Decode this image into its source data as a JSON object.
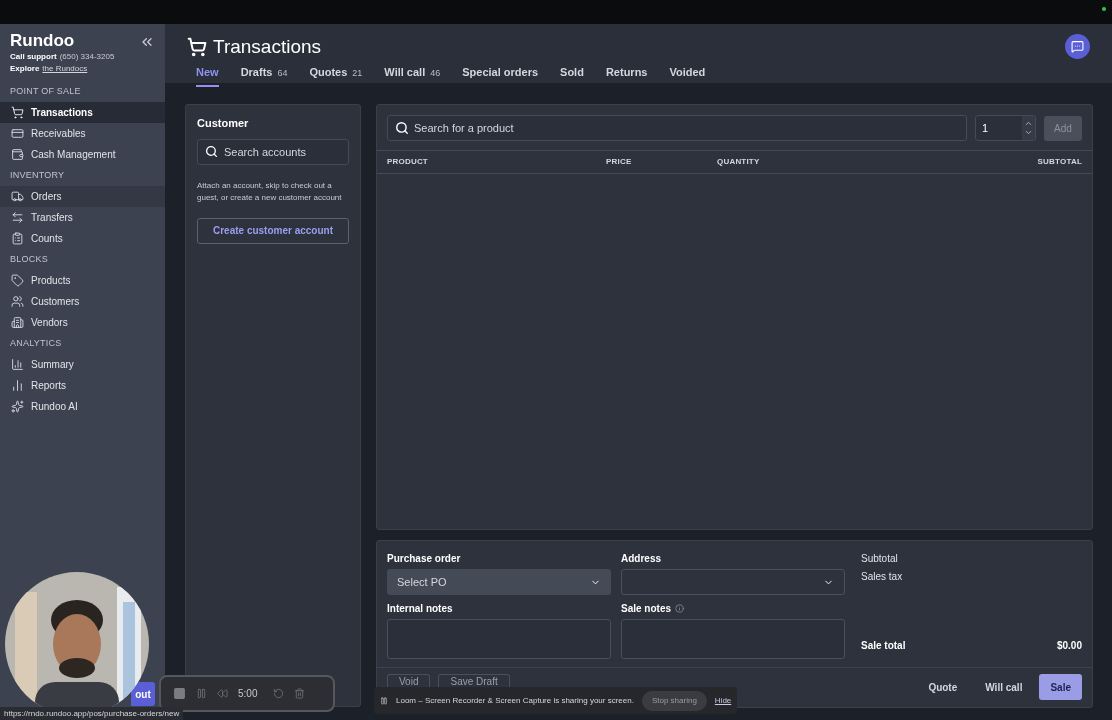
{
  "app": {
    "name": "Rundoo",
    "support_label": "Call support",
    "support_phone": "(650) 334-3205",
    "explore_label": "Explore",
    "explore_link": "the Rundocs"
  },
  "sidebar": {
    "sections": [
      {
        "title": "POINT OF SALE",
        "items": [
          {
            "label": "Transactions",
            "selected": true,
            "hovered": false
          },
          {
            "label": "Receivables",
            "selected": false,
            "hovered": false
          },
          {
            "label": "Cash Management",
            "selected": false,
            "hovered": false
          }
        ]
      },
      {
        "title": "INVENTORY",
        "items": [
          {
            "label": "Orders",
            "selected": false,
            "hovered": true
          },
          {
            "label": "Transfers",
            "selected": false,
            "hovered": false
          },
          {
            "label": "Counts",
            "selected": false,
            "hovered": false
          }
        ]
      },
      {
        "title": "BLOCKS",
        "items": [
          {
            "label": "Products",
            "selected": false,
            "hovered": false
          },
          {
            "label": "Customers",
            "selected": false,
            "hovered": false
          },
          {
            "label": "Vendors",
            "selected": false,
            "hovered": false
          }
        ]
      },
      {
        "title": "ANALYTICS",
        "items": [
          {
            "label": "Summary",
            "selected": false,
            "hovered": false
          },
          {
            "label": "Reports",
            "selected": false,
            "hovered": false
          },
          {
            "label": "Rundoo AI",
            "selected": false,
            "hovered": false
          }
        ]
      }
    ],
    "bottom_button": "out"
  },
  "page": {
    "title": "Transactions"
  },
  "tabs": [
    {
      "label": "New",
      "selected": true
    },
    {
      "label": "Drafts",
      "count": "64",
      "selected": false
    },
    {
      "label": "Quotes",
      "count": "21",
      "selected": false
    },
    {
      "label": "Will call",
      "count": "46",
      "selected": false
    },
    {
      "label": "Special orders",
      "selected": false
    },
    {
      "label": "Sold",
      "selected": false
    },
    {
      "label": "Returns",
      "selected": false
    },
    {
      "label": "Voided",
      "selected": false
    }
  ],
  "customer": {
    "title": "Customer",
    "search_placeholder": "Search accounts",
    "hint": "Attach an account, skip to check out a guest, or create a new customer account",
    "create_button": "Create customer account"
  },
  "products": {
    "search_placeholder": "Search for a product",
    "quantity": "1",
    "add_button": "Add",
    "add_disabled": true,
    "columns": [
      "PRODUCT",
      "PRICE",
      "QUANTITY",
      "SUBTOTAL"
    ]
  },
  "order": {
    "purchase_order_label": "Purchase order",
    "purchase_order_placeholder": "Select PO",
    "address_label": "Address",
    "internal_notes_label": "Internal notes",
    "sale_notes_label": "Sale notes",
    "subtotal_label": "Subtotal",
    "sales_tax_label": "Sales tax",
    "total_label": "Sale total",
    "total": "$0.00"
  },
  "actions": {
    "left": [
      "Void",
      "Save Draft"
    ],
    "right": [
      {
        "label": "Quote",
        "primary": false
      },
      {
        "label": "Will call",
        "primary": false
      },
      {
        "label": "Sale",
        "primary": true
      }
    ]
  },
  "recorder": {
    "timer": "5:00",
    "message": "Loom – Screen Recorder & Screen Capture is sharing your screen.",
    "stop_button": "Stop sharing",
    "hide_link": "Hide"
  },
  "status_url": "https://rndo.rundoo.app/pos/purchase-orders/new"
}
